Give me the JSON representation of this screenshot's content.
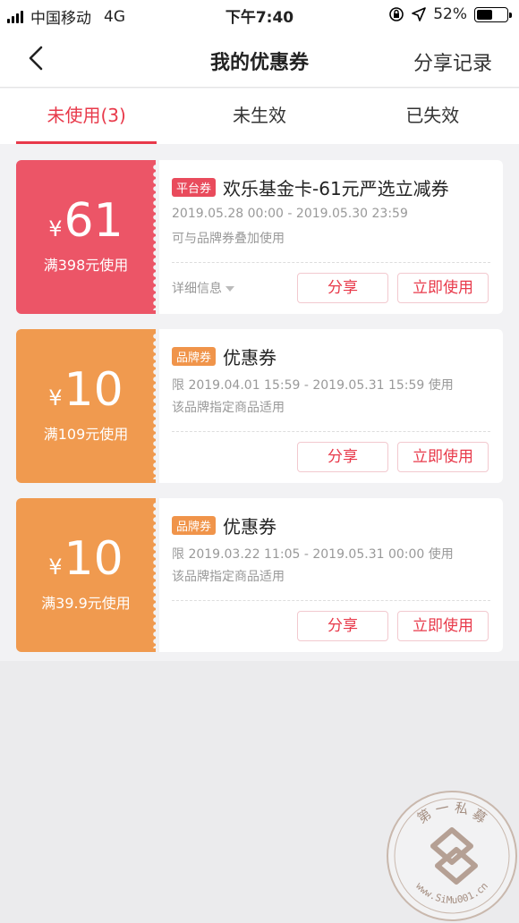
{
  "status_bar": {
    "carrier": "中国移动",
    "network": "4G",
    "time": "下午7:40",
    "battery": "52%",
    "battery_level": 0.52
  },
  "nav": {
    "title": "我的优惠券",
    "action": "分享记录"
  },
  "tabs": [
    {
      "label": "未使用(3)",
      "active": true
    },
    {
      "label": "未生效",
      "active": false
    },
    {
      "label": "已失效",
      "active": false
    }
  ],
  "colors": {
    "accent": "#e8394a",
    "platform_stub": "#ec5567",
    "brand_stub": "#f09a4f"
  },
  "coupons": [
    {
      "currency": "¥",
      "amount": "61",
      "condition": "满398元使用",
      "tag": "平台券",
      "title": "欢乐基金卡-61元严选立减券",
      "dates": "2019.05.28 00:00 - 2019.05.30 23:59",
      "note": "可与品牌券叠加使用",
      "detail": "详细信息",
      "share": "分享",
      "use": "立即使用"
    },
    {
      "currency": "¥",
      "amount": "10",
      "condition": "满109元使用",
      "tag": "品牌券",
      "title": "优惠券",
      "dates": "限 2019.04.01 15:59 - 2019.05.31 15:59 使用",
      "note": "该品牌指定商品适用",
      "share": "分享",
      "use": "立即使用"
    },
    {
      "currency": "¥",
      "amount": "10",
      "condition": "满39.9元使用",
      "tag": "品牌券",
      "title": "优惠券",
      "dates": "限 2019.03.22 11:05 - 2019.05.31 00:00 使用",
      "note": "该品牌指定商品适用",
      "share": "分享",
      "use": "立即使用"
    }
  ],
  "watermark": {
    "top_text": "第 一 私 募",
    "bottom_text": "www.SiMu001.cn"
  }
}
